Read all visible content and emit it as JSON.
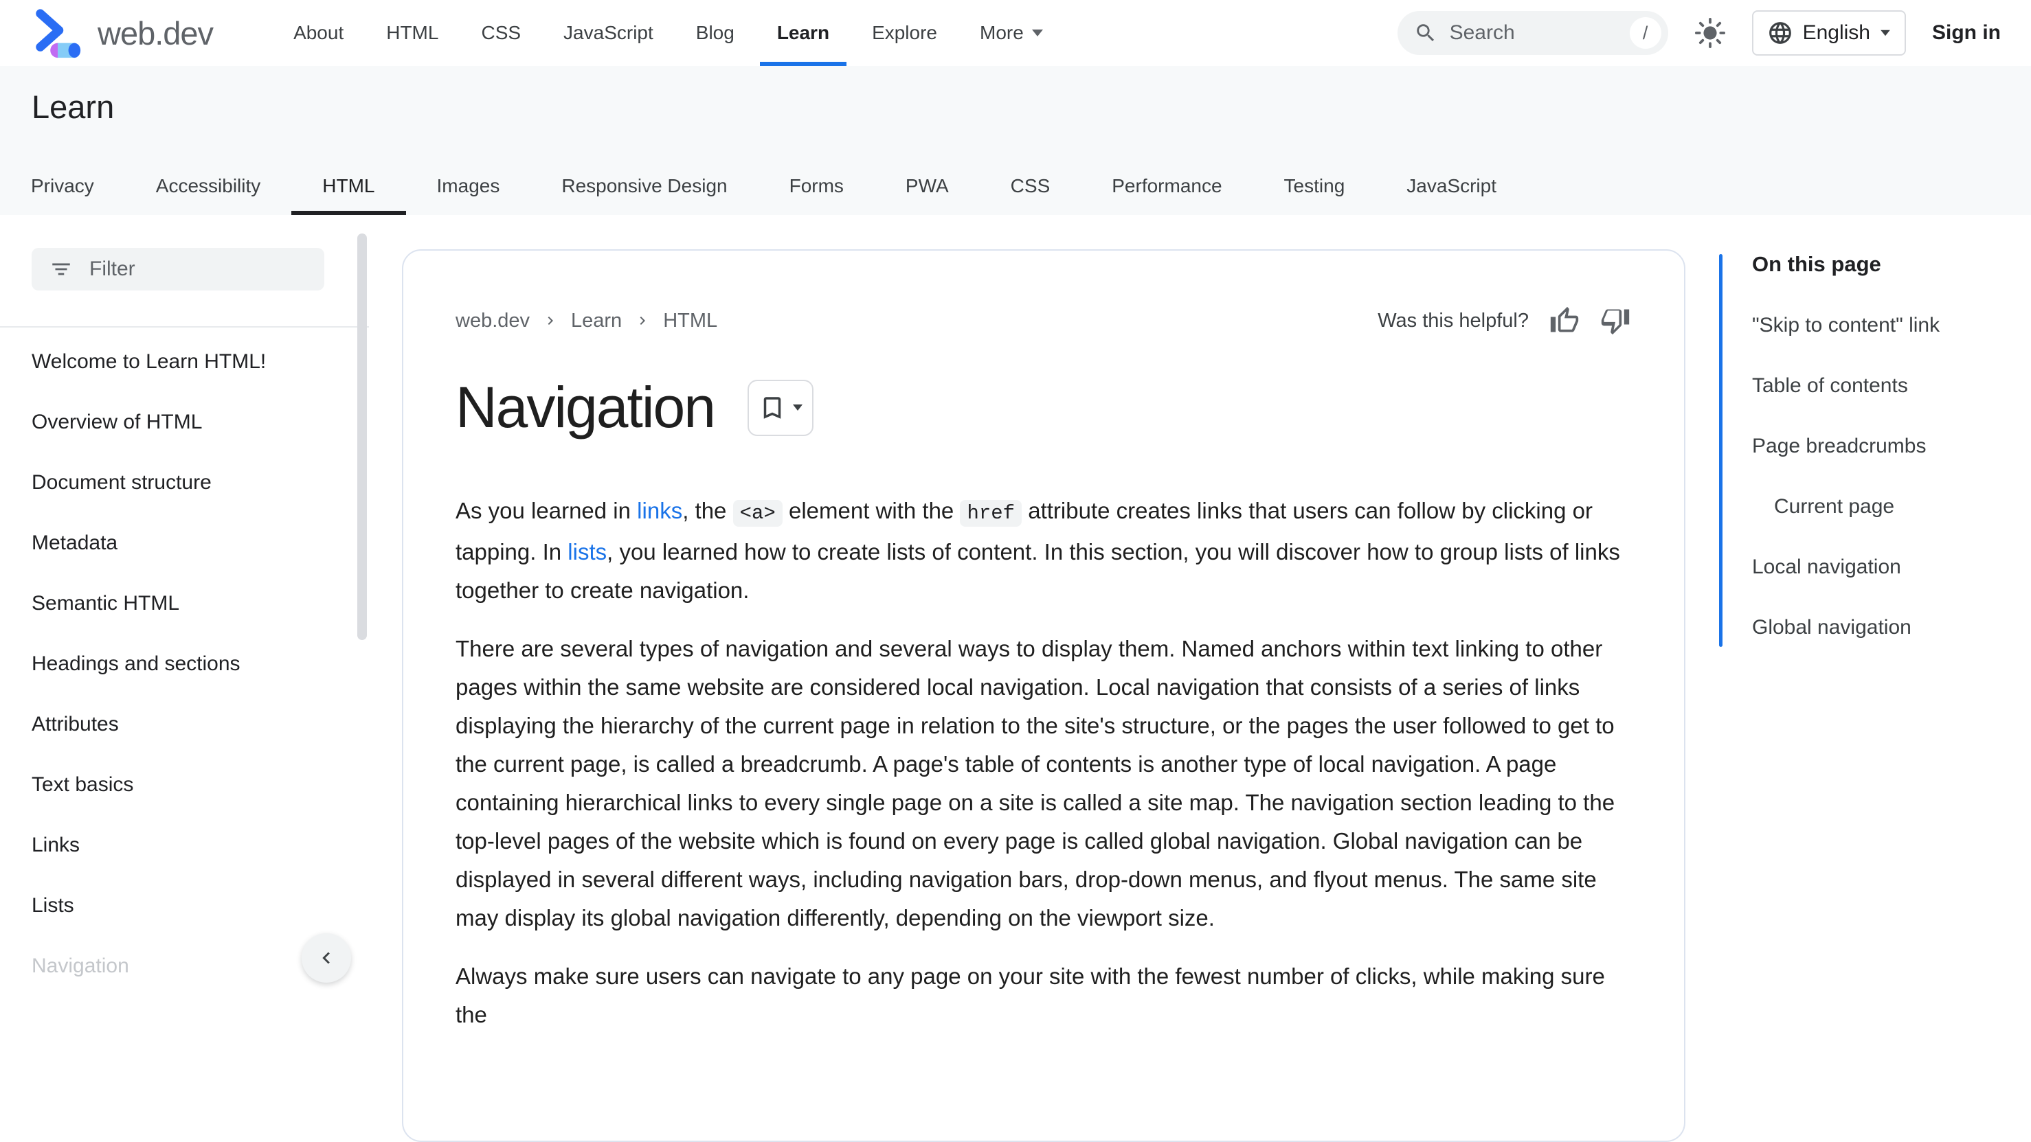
{
  "colors": {
    "accent_blue": "#1a73e8",
    "active_tab_underline": "#202124",
    "text_primary": "#202124",
    "text_secondary": "#5f6368",
    "surface_gray": "#f7f9fa",
    "chip_gray": "#f1f3f4"
  },
  "icons": {
    "logo": "web-dev-chevron-cylinder",
    "search": "magnifier",
    "shortcut_badge": "/",
    "theme": "sun",
    "language": "globe",
    "dropdown": "caret-down",
    "filter": "filter-lines",
    "breadcrumb_separator": "chevron-right",
    "thumb_up": "thumb-up-outline",
    "thumb_down": "thumb-down-outline",
    "bookmark": "bookmark-outline",
    "collapse": "chevron-left"
  },
  "header": {
    "brand": "web.dev",
    "nav": [
      {
        "label": "About"
      },
      {
        "label": "HTML"
      },
      {
        "label": "CSS"
      },
      {
        "label": "JavaScript"
      },
      {
        "label": "Blog"
      },
      {
        "label": "Learn",
        "active": true
      },
      {
        "label": "Explore"
      }
    ],
    "more_label": "More",
    "search": {
      "placeholder": "Search",
      "shortcut": "/"
    },
    "language": "English",
    "sign_in": "Sign in"
  },
  "hero": {
    "title": "Learn"
  },
  "course_tabs": [
    {
      "label": "Privacy"
    },
    {
      "label": "Accessibility"
    },
    {
      "label": "HTML",
      "active": true
    },
    {
      "label": "Images"
    },
    {
      "label": "Responsive Design"
    },
    {
      "label": "Forms"
    },
    {
      "label": "PWA"
    },
    {
      "label": "CSS"
    },
    {
      "label": "Performance"
    },
    {
      "label": "Testing"
    },
    {
      "label": "JavaScript"
    }
  ],
  "sidebar": {
    "filter_placeholder": "Filter",
    "items": [
      "Welcome to Learn HTML!",
      "Overview of HTML",
      "Document structure",
      "Metadata",
      "Semantic HTML",
      "Headings and sections",
      "Attributes",
      "Text basics",
      "Links",
      "Lists",
      "Navigation"
    ]
  },
  "article": {
    "breadcrumb": [
      "web.dev",
      "Learn",
      "HTML"
    ],
    "helpful_label": "Was this helpful?",
    "title": "Navigation",
    "p1": [
      {
        "t": "text",
        "v": "As you learned in "
      },
      {
        "t": "link",
        "v": "links"
      },
      {
        "t": "text",
        "v": ", the "
      },
      {
        "t": "code",
        "v": "<a>"
      },
      {
        "t": "text",
        "v": " element with the "
      },
      {
        "t": "code",
        "v": "href"
      },
      {
        "t": "text",
        "v": " attribute creates links that users can follow by clicking or tapping. In "
      },
      {
        "t": "link",
        "v": "lists"
      },
      {
        "t": "text",
        "v": ", you learned how to create lists of content. In this section, you will discover how to group lists of links together to create navigation."
      }
    ],
    "p2": "There are several types of navigation and several ways to display them. Named anchors within text linking to other pages within the same website are considered local navigation. Local navigation that consists of a series of links displaying the hierarchy of the current page in relation to the site's structure, or the pages the user followed to get to the current page, is called a breadcrumb. A page's table of contents is another type of local navigation. A page containing hierarchical links to every single page on a site is called a site map. The navigation section leading to the top-level pages of the website which is found on every page is called global navigation. Global navigation can be displayed in several different ways, including navigation bars, drop-down menus, and flyout menus. The same site may display its global navigation differently, depending on the viewport size.",
    "p3": "Always make sure users can navigate to any page on your site with the fewest number of clicks, while making sure the"
  },
  "toc": {
    "title": "On this page",
    "items": [
      {
        "label": "\"Skip to content\" link",
        "indent": false
      },
      {
        "label": "Table of contents",
        "indent": false
      },
      {
        "label": "Page breadcrumbs",
        "indent": false
      },
      {
        "label": "Current page",
        "indent": true
      },
      {
        "label": "Local navigation",
        "indent": false
      },
      {
        "label": "Global navigation",
        "indent": false
      }
    ]
  }
}
